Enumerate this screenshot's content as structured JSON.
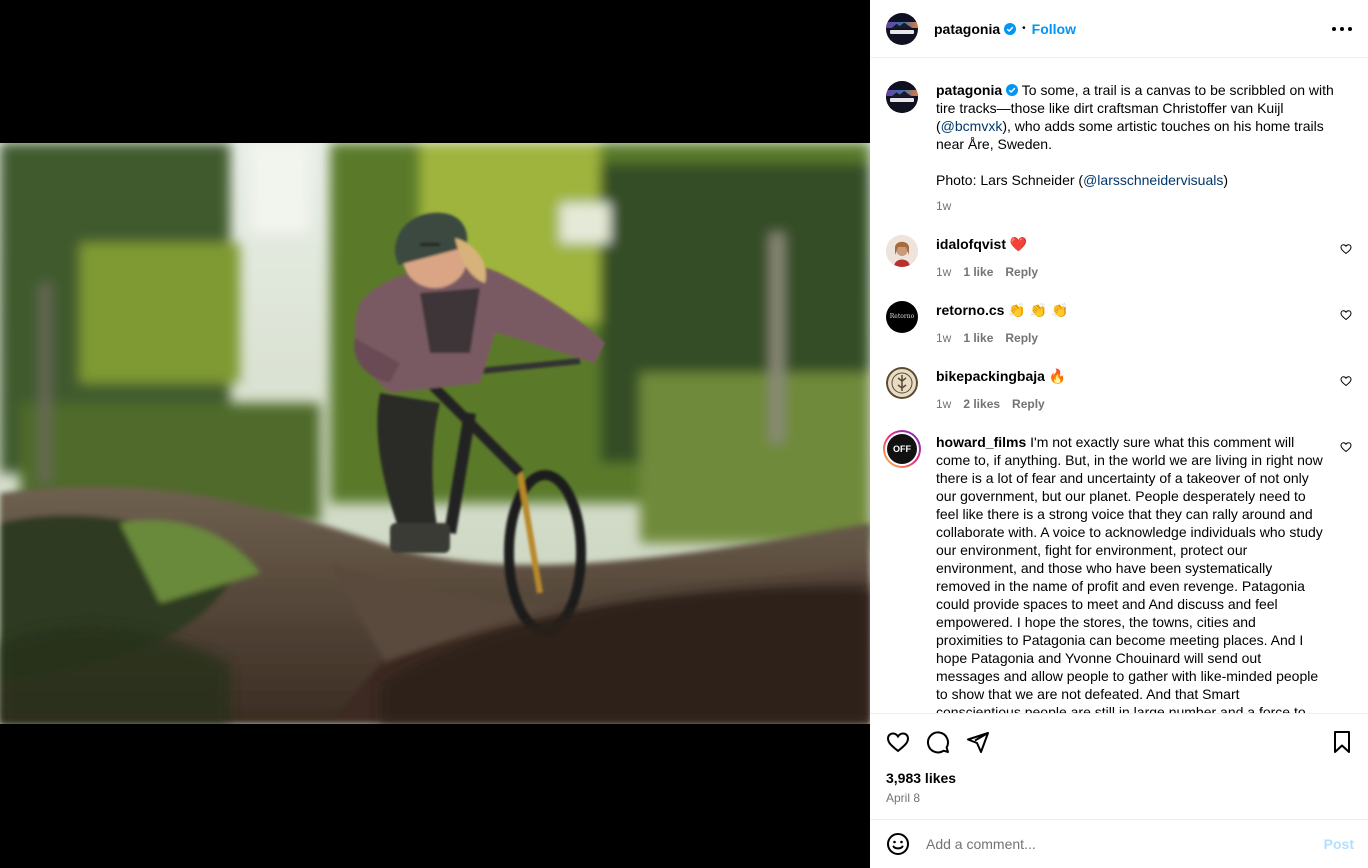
{
  "header": {
    "username": "patagonia",
    "separator": "•",
    "follow_label": "Follow",
    "verified_icon": "verified-badge-icon",
    "more_icon": "more-options-icon"
  },
  "caption": {
    "username": "patagonia",
    "text_1": " To some, a trail is a canvas to be scribbled on with tire tracks—those like dirt craftsman Christoffer van Kuijl (",
    "mention_1": "@bcmvxk",
    "text_2": "), who adds some artistic touches on his home trails near Åre, Sweden.",
    "photo_credit_prefix": "Photo: Lars Schneider (",
    "mention_2": "@larsschneidervisuals",
    "photo_credit_suffix": ")",
    "time": "1w"
  },
  "comments": [
    {
      "username": "idalofqvist",
      "text": " ❤️",
      "time": "1w",
      "likes": "1 like",
      "reply": "Reply"
    },
    {
      "username": "retorno.cs",
      "text": " 👏 👏 👏",
      "time": "1w",
      "likes": "1 like",
      "reply": "Reply"
    },
    {
      "username": "bikepackingbaja",
      "text": " 🔥",
      "time": "1w",
      "likes": "2 likes",
      "reply": "Reply"
    },
    {
      "username": "howard_films",
      "text": " I'm not exactly sure what this comment will come to, if anything. But, in the world we are living in right now there is a lot of fear and uncertainty of a takeover of not only our government, but our planet. People desperately need to feel like there is a strong voice that they can rally around and collaborate with. A voice to acknowledge individuals who study our environment, fight for environment, protect our environment, and those who have been systematically removed in the name of profit and even revenge. Patagonia could provide spaces to meet and And discuss and feel empowered. I hope the stores, the towns, cities and proximities to Patagonia can become meeting places. And I hope Patagonia and Yvonne Chouinard will send out messages and allow people to gather with like-minded people to show that we are not defeated. And that Smart conscientious people are still in large number and a force to be reckoned with... for the"
    }
  ],
  "avatar_labels": {
    "retorno": "Retorno",
    "howard": "OFF"
  },
  "actions": {
    "likes": "3,983 likes",
    "date": "April 8"
  },
  "add_comment": {
    "placeholder": "Add a comment...",
    "post_label": "Post"
  },
  "colors": {
    "link": "#00376b",
    "follow": "#0095f6",
    "muted": "#737373",
    "heart_red": "#ed4956"
  }
}
